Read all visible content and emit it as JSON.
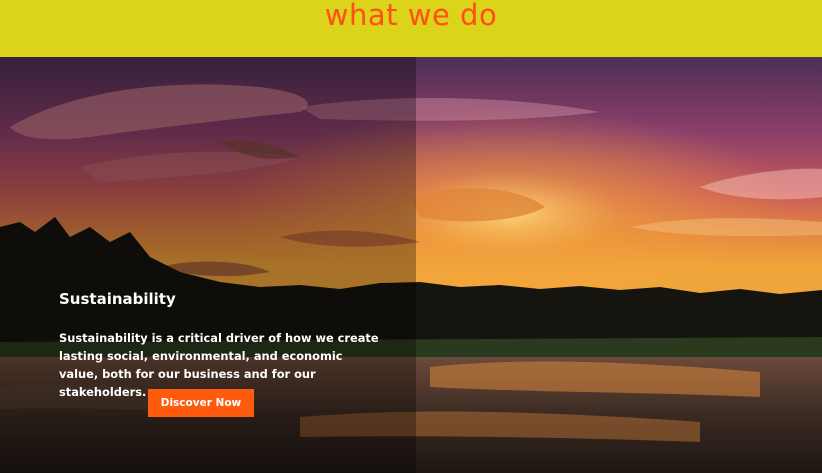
{
  "header": {
    "title": "what we do"
  },
  "hero": {
    "heading": "Sustainability",
    "description": "Sustainability is a critical driver of how we create lasting social, environmental, and economic value, both for our business and for our stakeholders.",
    "cta_label": "Discover Now"
  },
  "colors": {
    "header_bg": "#dcd41a",
    "title": "#ff4f12",
    "cta_bg": "#ff5b0f"
  }
}
